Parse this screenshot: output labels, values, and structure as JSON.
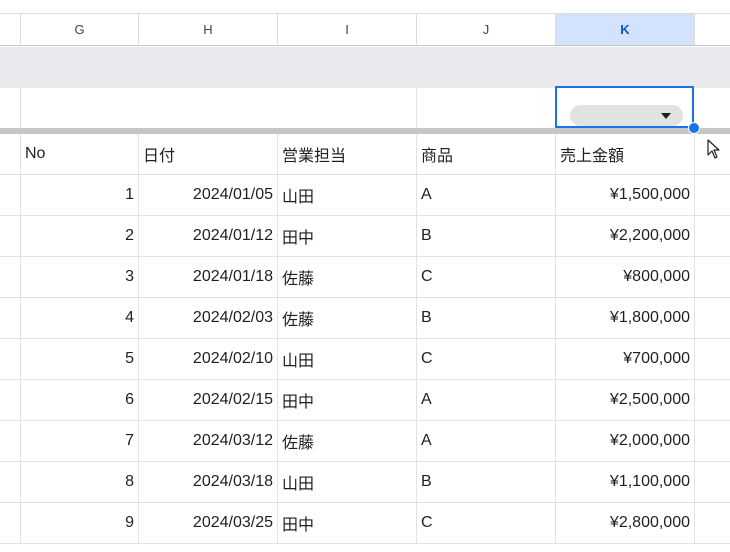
{
  "columns": [
    "G",
    "H",
    "I",
    "J",
    "K"
  ],
  "selected_column": "K",
  "headers": {
    "no": "No",
    "date": "日付",
    "rep": "営業担当",
    "product": "商品",
    "sales": "売上金額"
  },
  "rows": [
    {
      "no": "1",
      "date": "2024/01/05",
      "rep": "山田",
      "product": "A",
      "sales": "¥1,500,000"
    },
    {
      "no": "2",
      "date": "2024/01/12",
      "rep": "田中",
      "product": "B",
      "sales": "¥2,200,000"
    },
    {
      "no": "3",
      "date": "2024/01/18",
      "rep": "佐藤",
      "product": "C",
      "sales": "¥800,000"
    },
    {
      "no": "4",
      "date": "2024/02/03",
      "rep": "佐藤",
      "product": "B",
      "sales": "¥1,800,000"
    },
    {
      "no": "5",
      "date": "2024/02/10",
      "rep": "山田",
      "product": "C",
      "sales": "¥700,000"
    },
    {
      "no": "6",
      "date": "2024/02/15",
      "rep": "田中",
      "product": "A",
      "sales": "¥2,500,000"
    },
    {
      "no": "7",
      "date": "2024/03/12",
      "rep": "佐藤",
      "product": "A",
      "sales": "¥2,000,000"
    },
    {
      "no": "8",
      "date": "2024/03/18",
      "rep": "山田",
      "product": "B",
      "sales": "¥1,100,000"
    },
    {
      "no": "9",
      "date": "2024/03/25",
      "rep": "田中",
      "product": "C",
      "sales": "¥2,800,000"
    }
  ],
  "colors": {
    "selected_header_bg": "#d3e3fd",
    "selection_border": "#1a73e8",
    "band_bg": "#e8eaed",
    "gridline": "#e1e3e1"
  },
  "icons": {
    "dropdown": "dropdown-arrow-icon",
    "cursor": "mouse-pointer-icon"
  }
}
